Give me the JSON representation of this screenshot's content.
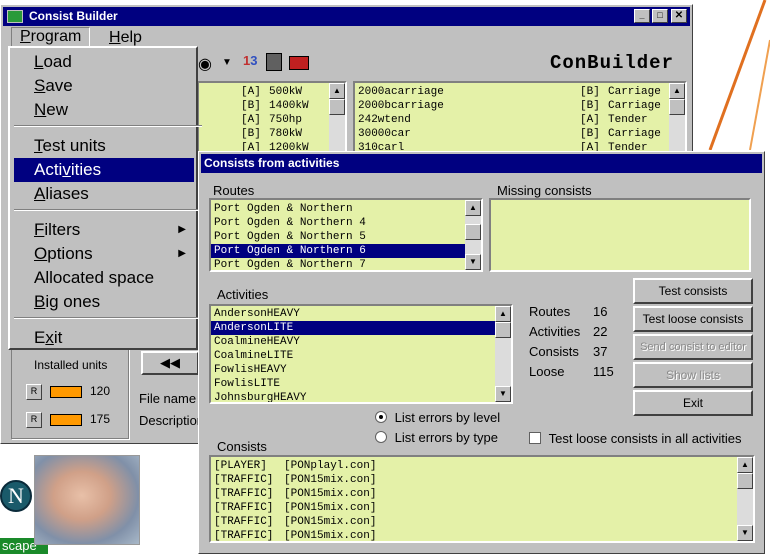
{
  "main_window": {
    "title": "Consist Builder",
    "menu": {
      "program": "Program",
      "help": "Help"
    },
    "brand": "ConBuilder",
    "units": [
      {
        "code": "[A]",
        "value": "500kW"
      },
      {
        "code": "[B]",
        "value": "1400kW"
      },
      {
        "code": "[A]",
        "value": "750hp"
      },
      {
        "code": "[B]",
        "value": "780kW"
      },
      {
        "code": "[A]",
        "value": "1200kW"
      }
    ],
    "cars": [
      {
        "name": "2000acarriage",
        "code": "[B]",
        "type": "Carriage"
      },
      {
        "name": "2000bcarriage",
        "code": "[B]",
        "type": "Carriage"
      },
      {
        "name": "242wtend",
        "code": "[A]",
        "type": "Tender"
      },
      {
        "name": "30000car",
        "code": "[B]",
        "type": "Carriage"
      },
      {
        "name": "310carl",
        "code": "[A]",
        "type": "Tender"
      }
    ],
    "installed_units": {
      "title": "Installed units",
      "r_label": "R",
      "engines": "120",
      "wagons": "175"
    },
    "nav_rewind": "◀◀",
    "file_name_label": "File name",
    "description_label": "Description"
  },
  "program_menu": {
    "items": [
      {
        "label": "Load",
        "underline": "L"
      },
      {
        "label": "Save",
        "underline": "S"
      },
      {
        "label": "New",
        "underline": "N"
      },
      {
        "label": "Test units",
        "underline": "T"
      },
      {
        "label": "Activities",
        "underline": "v"
      },
      {
        "label": "Aliases",
        "underline": "A"
      },
      {
        "label": "Filters",
        "underline": "F"
      },
      {
        "label": "Options",
        "underline": "O"
      },
      {
        "label": "Allocated space",
        "underline": ""
      },
      {
        "label": "Big ones",
        "underline": "B"
      },
      {
        "label": "Exit",
        "underline": "x"
      }
    ]
  },
  "dialog": {
    "title": "Consists from activities",
    "routes_label": "Routes",
    "missing_label": "Missing consists",
    "routes": [
      "Port Ogden & Northern",
      "Port Ogden & Northern 4",
      "Port Ogden & Northern 5",
      "Port Ogden & Northern 6",
      "Port Ogden & Northern 7"
    ],
    "selected_route": 3,
    "activities_label": "Activities",
    "activities": [
      "AndersonHEAVY",
      "AndersonLITE",
      "CoalmineHEAVY",
      "CoalmineLITE",
      "FowlisHEAVY",
      "FowlisLITE",
      "JohnsburgHEAVY"
    ],
    "selected_activity": 1,
    "stats": [
      {
        "label": "Routes",
        "value": "16"
      },
      {
        "label": "Activities",
        "value": "22"
      },
      {
        "label": "Consists",
        "value": "37"
      },
      {
        "label": "Loose",
        "value": "115"
      }
    ],
    "buttons": {
      "test_consists": "Test consists",
      "test_loose": "Test loose consists",
      "send_to_editor": "Send consist to editor",
      "show_lists": "Show lists",
      "exit": "Exit"
    },
    "radio_level": "List errors by level",
    "radio_type": "List errors by type",
    "radio_selected": "level",
    "checkbox_loose": "Test loose consists in all activities",
    "checkbox_checked": false,
    "consists_label": "Consists",
    "consists": [
      {
        "kind": "[PLAYER]",
        "file": "[PONplayl.con]"
      },
      {
        "kind": "[TRAFFIC]",
        "file": "[PON15mix.con]"
      },
      {
        "kind": "[TRAFFIC]",
        "file": "[PON15mix.con]"
      },
      {
        "kind": "[TRAFFIC]",
        "file": "[PON15mix.con]"
      },
      {
        "kind": "[TRAFFIC]",
        "file": "[PON15mix.con]"
      },
      {
        "kind": "[TRAFFIC]",
        "file": "[PON15mix.con]"
      }
    ]
  },
  "desktop": {
    "netscape_label": "scape"
  },
  "colors": {
    "titlebar": "#000080",
    "list_bg": "#e4f1a8",
    "selection": "#000080"
  }
}
